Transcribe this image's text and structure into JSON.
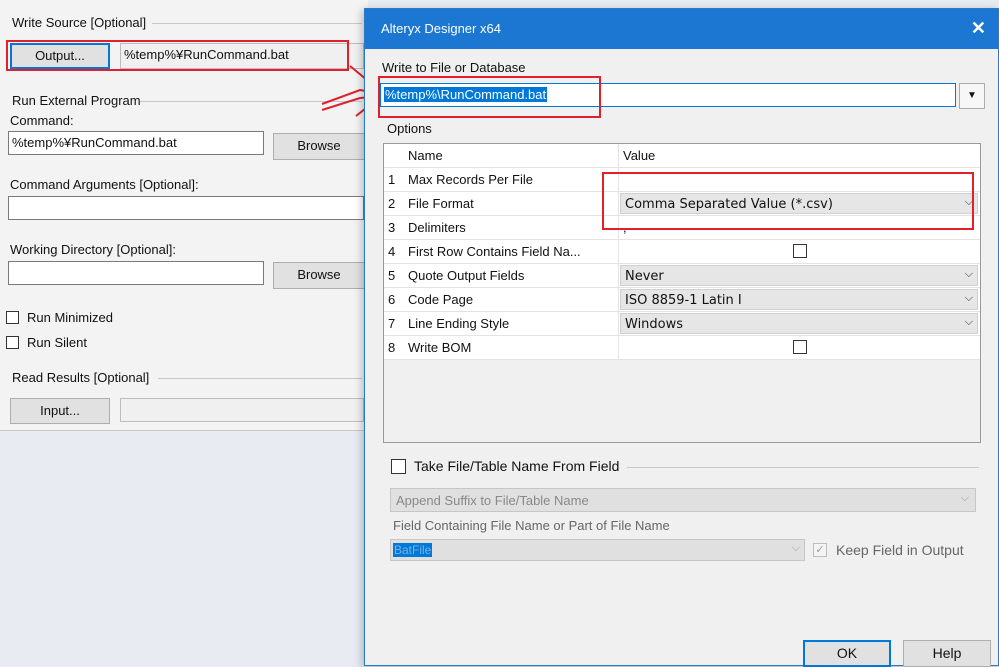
{
  "left_panel": {
    "write_source_label": "Write Source [Optional]",
    "output_button": "Output...",
    "output_value": "%temp%¥RunCommand.bat",
    "run_external_label": "Run External Program",
    "command_label": "Command:",
    "command_value": "%temp%¥RunCommand.bat",
    "browse_label": "Browse",
    "command_args_label": "Command Arguments [Optional]:",
    "command_args_value": "",
    "working_dir_label": "Working Directory [Optional]:",
    "working_dir_value": "",
    "run_minimized_label": "Run Minimized",
    "run_silent_label": "Run Silent",
    "read_results_label": "Read Results [Optional]",
    "input_button": "Input...",
    "input_value": ""
  },
  "dialog": {
    "title": "Alteryx Designer x64",
    "close_glyph": "✕",
    "write_to_label": "Write to File or Database",
    "path_value": "%temp%\\RunCommand.bat",
    "options_label": "Options",
    "columns": {
      "name": "Name",
      "value": "Value"
    },
    "rows": [
      {
        "num": "1",
        "name": "Max Records Per File",
        "value": ""
      },
      {
        "num": "2",
        "name": "File Format",
        "value": "Comma Separated Value (*.csv)"
      },
      {
        "num": "3",
        "name": "Delimiters",
        "value": ","
      },
      {
        "num": "4",
        "name": "First Row Contains Field Na...",
        "value": ""
      },
      {
        "num": "5",
        "name": "Quote Output Fields",
        "value": "Never"
      },
      {
        "num": "6",
        "name": "Code Page",
        "value": "ISO 8859-1 Latin I"
      },
      {
        "num": "7",
        "name": "Line Ending Style",
        "value": "Windows"
      },
      {
        "num": "8",
        "name": "Write BOM",
        "value": ""
      }
    ],
    "take_file_label": "Take File/Table Name From Field",
    "append_suffix_value": "Append Suffix to File/Table Name",
    "field_containing_label": "Field Containing File Name or Part of File Name",
    "field_value": "BatFile",
    "keep_field_label": "Keep Field in Output",
    "ok_label": "OK",
    "help_label": "Help"
  },
  "colors": {
    "title_bar": "#1b77d2",
    "highlight": "#e0202a",
    "selection": "#0078d7"
  }
}
